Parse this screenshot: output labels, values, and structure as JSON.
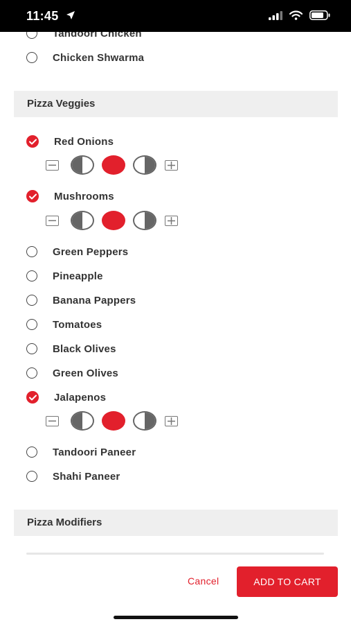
{
  "status_bar": {
    "time": "11:45"
  },
  "meats_tail": [
    {
      "label": "Tandoori Chicken",
      "selected": false
    },
    {
      "label": "Chicken Shwarma",
      "selected": false
    }
  ],
  "veggies": {
    "title": "Pizza Veggies",
    "items": [
      {
        "label": "Red Onions",
        "selected": true,
        "portion": "whole"
      },
      {
        "label": "Mushrooms",
        "selected": true,
        "portion": "whole"
      },
      {
        "label": "Green Peppers",
        "selected": false
      },
      {
        "label": "Pineapple",
        "selected": false
      },
      {
        "label": "Banana Pappers",
        "selected": false
      },
      {
        "label": "Tomatoes",
        "selected": false
      },
      {
        "label": "Black Olives",
        "selected": false
      },
      {
        "label": "Green Olives",
        "selected": false
      },
      {
        "label": "Jalapenos",
        "selected": true,
        "portion": "whole"
      },
      {
        "label": "Tandoori Paneer",
        "selected": false
      },
      {
        "label": "Shahi Paneer",
        "selected": false
      }
    ]
  },
  "modifiers": {
    "title": "Pizza Modifiers"
  },
  "footer": {
    "cancel_label": "Cancel",
    "add_to_cart_label": "ADD TO CART"
  },
  "colors": {
    "accent": "#e2202c",
    "section_bg": "#efefef"
  }
}
